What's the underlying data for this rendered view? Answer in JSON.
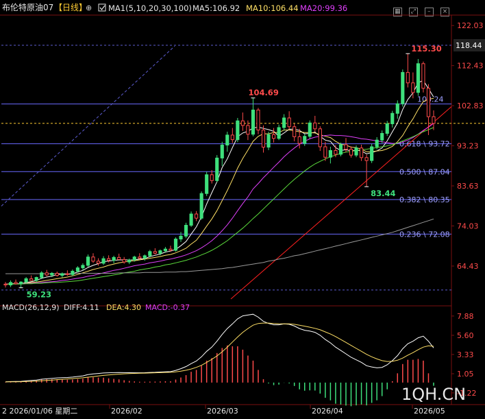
{
  "header": {
    "instrument": "布伦特原油07",
    "period": "【日线】",
    "ma_label": "MA1(5,10,20,30,100)",
    "ma5": "MA5:106.92",
    "ma10": "MA10:106.44",
    "ma20": "MA20:99.36",
    "icons": [
      "grid-icon",
      "expand-icon",
      "minimize-icon",
      "close-icon"
    ]
  },
  "macd_header": {
    "label": "MACD(26,12,9)",
    "diff": "DIFF:4.11",
    "dea": "DEA:4.30",
    "macd": "MACD:-0.37"
  },
  "watermark": "1QH.CN",
  "colors": {
    "up": "#3ee07c",
    "down": "#ff4b4b",
    "ma5": "#ffffff",
    "ma10": "#ffe066",
    "ma20": "#e040fb",
    "ma30": "#5cdc3c",
    "ma100": "#9a9a9a",
    "fib": "#6a6aff",
    "trend": "#ff2020",
    "price_line": "#ffcc33"
  },
  "chart_data": {
    "type": "candlestick",
    "y_ticks": [
      "122.03",
      "112.43",
      "102.83",
      "93.23",
      "83.63",
      "74.03",
      "64.43"
    ],
    "ylim": [
      57.2,
      124.2
    ],
    "current_price": "118.44",
    "x_ticks": [
      "2026/02",
      "2026/03",
      "2026/04",
      "2026/05"
    ],
    "date_label": "2  2026/01/06 星期二",
    "annotations": [
      {
        "text": "115.30",
        "value": 115.3
      },
      {
        "text": "104.69",
        "value": 104.69
      },
      {
        "text": "83.44",
        "value": 83.44
      },
      {
        "text": "59.23",
        "value": 59.23
      }
    ],
    "levels": [
      {
        "label": "",
        "value": 117.3
      },
      {
        "label": "103.24",
        "value": 103.24
      },
      {
        "label": "0.618 \\ 93.72",
        "value": 93.72
      },
      {
        "label": "0.500 \\ 87.04",
        "value": 87.04
      },
      {
        "label": "0.382 \\ 80.35",
        "value": 80.35
      },
      {
        "label": "0.236 \\ 72.08",
        "value": 72.08
      }
    ],
    "macd_ticks": [
      "7.88",
      "5.60",
      "3.33",
      "1.05",
      "-1.22"
    ],
    "macd_ylim": [
      -2.2,
      8.6
    ],
    "candles": [
      [
        60.1,
        60.6,
        59.3,
        59.9
      ],
      [
        59.9,
        61.0,
        59.4,
        60.5
      ],
      [
        60.5,
        61.2,
        60.0,
        60.2
      ],
      [
        60.2,
        60.8,
        59.23,
        60.6
      ],
      [
        60.6,
        61.8,
        60.3,
        61.4
      ],
      [
        61.4,
        62.2,
        60.9,
        61.0
      ],
      [
        61.0,
        61.9,
        60.6,
        61.7
      ],
      [
        61.7,
        63.2,
        61.3,
        62.8
      ],
      [
        62.8,
        63.5,
        62.0,
        62.3
      ],
      [
        62.3,
        63.0,
        61.8,
        62.7
      ],
      [
        62.7,
        63.1,
        61.9,
        62.2
      ],
      [
        62.2,
        62.9,
        61.7,
        62.6
      ],
      [
        62.6,
        63.4,
        62.1,
        62.4
      ],
      [
        62.4,
        63.6,
        62.0,
        63.2
      ],
      [
        63.2,
        64.4,
        62.9,
        64.0
      ],
      [
        64.0,
        65.1,
        63.5,
        64.6
      ],
      [
        64.6,
        67.2,
        64.2,
        66.6
      ],
      [
        66.6,
        67.5,
        65.2,
        65.6
      ],
      [
        65.6,
        66.3,
        64.5,
        65.1
      ],
      [
        65.1,
        66.8,
        64.7,
        66.2
      ],
      [
        66.2,
        67.0,
        65.3,
        65.8
      ],
      [
        65.8,
        66.9,
        65.1,
        66.5
      ],
      [
        66.5,
        67.4,
        65.9,
        66.0
      ],
      [
        66.0,
        66.6,
        65.0,
        65.4
      ],
      [
        65.4,
        66.2,
        64.9,
        65.9
      ],
      [
        65.9,
        66.9,
        65.5,
        66.6
      ],
      [
        66.6,
        67.5,
        66.0,
        66.3
      ],
      [
        66.3,
        67.2,
        65.7,
        66.9
      ],
      [
        66.9,
        68.3,
        66.5,
        67.9
      ],
      [
        67.9,
        68.7,
        67.2,
        67.5
      ],
      [
        67.5,
        68.4,
        67.0,
        68.1
      ],
      [
        68.1,
        69.0,
        67.6,
        68.5
      ],
      [
        68.5,
        69.3,
        67.9,
        68.2
      ],
      [
        68.2,
        71.3,
        67.9,
        70.9
      ],
      [
        70.9,
        72.6,
        70.2,
        71.6
      ],
      [
        71.6,
        74.8,
        71.1,
        74.2
      ],
      [
        74.2,
        77.5,
        73.8,
        76.9
      ],
      [
        76.9,
        77.6,
        75.2,
        75.9
      ],
      [
        75.9,
        82.3,
        75.5,
        81.8
      ],
      [
        81.8,
        87.0,
        81.2,
        86.3
      ],
      [
        86.3,
        87.4,
        84.2,
        84.9
      ],
      [
        84.9,
        91.0,
        84.5,
        90.3
      ],
      [
        90.3,
        94.2,
        88.4,
        93.4
      ],
      [
        93.4,
        96.6,
        91.8,
        95.8
      ],
      [
        95.8,
        97.5,
        93.9,
        94.7
      ],
      [
        94.7,
        99.9,
        94.1,
        99.2
      ],
      [
        99.2,
        101.2,
        96.8,
        98.1
      ],
      [
        98.1,
        99.3,
        94.6,
        96.0
      ],
      [
        96.0,
        104.69,
        95.5,
        101.8
      ],
      [
        101.8,
        102.3,
        96.0,
        97.0
      ],
      [
        97.0,
        98.1,
        91.6,
        92.9
      ],
      [
        92.9,
        96.6,
        92.2,
        95.9
      ],
      [
        95.9,
        97.5,
        94.0,
        95.0
      ],
      [
        95.0,
        98.3,
        94.6,
        97.6
      ],
      [
        97.6,
        100.8,
        96.9,
        99.9
      ],
      [
        99.9,
        101.5,
        97.1,
        97.8
      ],
      [
        97.8,
        98.5,
        94.3,
        95.4
      ],
      [
        95.4,
        97.3,
        92.6,
        93.8
      ],
      [
        93.8,
        96.1,
        93.2,
        95.5
      ],
      [
        95.5,
        99.3,
        95.0,
        98.7
      ],
      [
        98.7,
        100.4,
        96.6,
        97.3
      ],
      [
        97.3,
        97.9,
        92.0,
        93.0
      ],
      [
        93.0,
        94.2,
        89.6,
        90.5
      ],
      [
        90.5,
        93.0,
        89.0,
        92.1
      ],
      [
        92.1,
        93.4,
        90.5,
        91.2
      ],
      [
        91.2,
        94.0,
        90.7,
        93.5
      ],
      [
        93.5,
        95.1,
        91.7,
        92.4
      ],
      [
        92.4,
        93.1,
        90.4,
        91.0
      ],
      [
        91.0,
        93.3,
        90.5,
        92.7
      ],
      [
        92.7,
        93.5,
        89.6,
        90.4
      ],
      [
        90.4,
        91.1,
        83.44,
        89.7
      ],
      [
        89.7,
        93.7,
        89.1,
        93.0
      ],
      [
        93.0,
        95.3,
        92.4,
        94.6
      ],
      [
        94.6,
        96.9,
        93.9,
        96.2
      ],
      [
        96.2,
        99.2,
        95.6,
        98.5
      ],
      [
        98.5,
        101.6,
        97.6,
        101.0
      ],
      [
        101.0,
        104.1,
        99.7,
        103.3
      ],
      [
        103.3,
        111.5,
        102.6,
        110.8
      ],
      [
        110.8,
        115.3,
        107.2,
        108.3
      ],
      [
        108.3,
        110.8,
        104.6,
        106.0
      ],
      [
        106.0,
        114.0,
        105.2,
        112.9
      ],
      [
        112.9,
        113.4,
        106.0,
        107.0
      ],
      [
        107.0,
        108.0,
        95.8,
        100.2
      ],
      [
        100.2,
        101.7,
        97.0,
        98.6
      ]
    ],
    "series": [
      {
        "name": "MA5",
        "values": [
          60.1,
          60.2,
          60.2,
          60.2,
          60.5,
          60.7,
          61.0,
          61.5,
          61.8,
          62.0,
          62.4,
          62.5,
          62.4,
          62.6,
          63.0,
          63.4,
          64.1,
          64.6,
          65.0,
          65.5,
          65.6,
          65.8,
          65.9,
          65.9,
          65.9,
          65.9,
          66.1,
          66.2,
          66.7,
          67.0,
          67.3,
          67.8,
          68.0,
          68.4,
          69.3,
          70.3,
          72.1,
          73.8,
          76.2,
          79.3,
          82.0,
          84.6,
          88.0,
          90.1,
          92.8,
          95.4,
          96.3,
          96.7,
          97.5,
          97.7,
          97.4,
          97.1,
          96.7,
          95.5,
          96.3,
          97.2,
          97.2,
          96.9,
          96.1,
          96.2,
          96.5,
          95.5,
          94.6,
          94.3,
          92.8,
          92.1,
          92.3,
          92.0,
          92.2,
          92.0,
          91.3,
          91.6,
          92.0,
          92.7,
          94.4,
          96.6,
          98.7,
          101.9,
          104.3,
          105.9,
          108.3,
          108.9,
          106.9,
          104.9
        ]
      },
      {
        "name": "MA10",
        "values": [
          60.1,
          60.2,
          60.2,
          60.2,
          60.4,
          60.5,
          60.6,
          60.8,
          61.0,
          61.2,
          61.4,
          61.6,
          61.8,
          62.1,
          62.4,
          62.8,
          63.2,
          63.6,
          63.9,
          64.2,
          64.6,
          64.9,
          65.2,
          65.4,
          65.6,
          65.7,
          65.9,
          66.1,
          66.3,
          66.5,
          66.7,
          67.0,
          67.2,
          67.6,
          68.1,
          68.7,
          69.7,
          70.6,
          72.2,
          74.0,
          75.7,
          77.7,
          80.1,
          82.5,
          85.1,
          87.9,
          90.2,
          92.2,
          94.3,
          95.5,
          96.1,
          96.1,
          96.4,
          96.4,
          97.0,
          97.0,
          96.8,
          96.6,
          96.4,
          96.4,
          96.3,
          95.9,
          95.5,
          95.2,
          94.3,
          93.6,
          93.4,
          92.9,
          92.8,
          92.4,
          91.8,
          91.8,
          92.0,
          92.1,
          92.5,
          93.1,
          94.2,
          95.7,
          97.8,
          99.7,
          101.9,
          103.8,
          104.4,
          104.6
        ]
      },
      {
        "name": "MA20",
        "values": [
          60.1,
          60.1,
          60.2,
          60.2,
          60.3,
          60.3,
          60.4,
          60.5,
          60.6,
          60.7,
          60.8,
          61.0,
          61.1,
          61.3,
          61.5,
          61.7,
          62.0,
          62.2,
          62.5,
          62.8,
          63.1,
          63.4,
          63.6,
          63.9,
          64.2,
          64.5,
          64.7,
          64.9,
          65.2,
          65.4,
          65.6,
          65.9,
          66.1,
          66.4,
          66.7,
          67.1,
          67.6,
          68.1,
          68.8,
          69.6,
          70.5,
          71.6,
          72.9,
          74.3,
          75.9,
          77.7,
          79.4,
          81.0,
          82.9,
          84.2,
          85.6,
          86.8,
          88.1,
          89.3,
          90.6,
          91.7,
          92.7,
          93.6,
          94.3,
          94.9,
          95.3,
          95.5,
          95.7,
          95.8,
          95.7,
          95.7,
          95.6,
          95.4,
          95.2,
          94.9,
          94.8,
          94.6,
          94.4,
          94.2,
          94.0,
          93.8,
          93.8,
          94.1,
          94.6,
          95.2,
          96.0,
          96.9,
          97.7,
          98.6
        ]
      },
      {
        "name": "MA30",
        "values": [
          60.0,
          60.1,
          60.1,
          60.1,
          60.2,
          60.2,
          60.3,
          60.3,
          60.4,
          60.5,
          60.5,
          60.6,
          60.7,
          60.8,
          60.9,
          61.1,
          61.3,
          61.5,
          61.7,
          61.9,
          62.1,
          62.3,
          62.5,
          62.8,
          63.0,
          63.2,
          63.5,
          63.7,
          63.9,
          64.2,
          64.4,
          64.7,
          64.9,
          65.2,
          65.5,
          65.8,
          66.2,
          66.6,
          67.1,
          67.6,
          68.2,
          68.9,
          69.7,
          70.5,
          71.5,
          72.5,
          73.5,
          74.6,
          75.8,
          76.9,
          78.1,
          79.3,
          80.5,
          81.7,
          82.9,
          84.1,
          85.2,
          86.2,
          87.2,
          88.1,
          88.9,
          89.5,
          90.1,
          90.6,
          91.0,
          91.4,
          91.7,
          91.9,
          92.1,
          92.3,
          92.4,
          92.6,
          92.8,
          93.0,
          93.2,
          93.5,
          93.9,
          94.4,
          94.9,
          95.4,
          96.0,
          96.6,
          97.1,
          97.6
        ]
      },
      {
        "name": "MA100",
        "values": [
          62.6,
          62.6,
          62.6,
          62.6,
          62.6,
          62.6,
          62.6,
          62.6,
          62.6,
          62.6,
          62.6,
          62.6,
          62.6,
          62.6,
          62.7,
          62.7,
          62.7,
          62.7,
          62.7,
          62.7,
          62.7,
          62.7,
          62.8,
          62.8,
          62.8,
          62.8,
          62.8,
          62.9,
          62.9,
          62.9,
          62.9,
          63.0,
          63.0,
          63.0,
          63.1,
          63.1,
          63.2,
          63.3,
          63.4,
          63.5,
          63.6,
          63.7,
          63.8,
          64.0,
          64.1,
          64.3,
          64.5,
          64.7,
          64.9,
          65.1,
          65.3,
          65.6,
          65.8,
          66.1,
          66.3,
          66.6,
          66.9,
          67.1,
          67.4,
          67.7,
          68.0,
          68.3,
          68.6,
          68.9,
          69.2,
          69.5,
          69.8,
          70.1,
          70.4,
          70.7,
          71.0,
          71.3,
          71.6,
          71.9,
          72.2,
          72.5,
          72.9,
          73.3,
          73.7,
          74.1,
          74.5,
          74.9,
          75.3,
          75.7
        ]
      }
    ],
    "macd_dif": [
      0.1,
      0.12,
      0.13,
      0.15,
      0.2,
      0.25,
      0.3,
      0.4,
      0.45,
      0.5,
      0.55,
      0.58,
      0.6,
      0.65,
      0.72,
      0.8,
      0.95,
      1.02,
      1.08,
      1.14,
      1.16,
      1.18,
      1.19,
      1.18,
      1.17,
      1.16,
      1.16,
      1.17,
      1.2,
      1.22,
      1.25,
      1.28,
      1.3,
      1.45,
      1.65,
      1.9,
      2.25,
      2.55,
      3.05,
      3.7,
      4.2,
      4.9,
      5.7,
      6.4,
      6.95,
      7.55,
      7.9,
      8.0,
      8.1,
      7.75,
      7.25,
      7.0,
      6.85,
      6.85,
      6.95,
      6.9,
      6.7,
      6.4,
      6.2,
      6.1,
      5.95,
      5.6,
      5.1,
      4.7,
      4.2,
      3.8,
      3.4,
      3.0,
      2.7,
      2.4,
      2.0,
      1.85,
      1.75,
      1.8,
      2.1,
      2.6,
      3.2,
      4.0,
      4.6,
      4.9,
      5.3,
      5.5,
      4.9,
      4.11
    ],
    "macd_dea": [
      0.08,
      0.09,
      0.1,
      0.11,
      0.13,
      0.15,
      0.18,
      0.22,
      0.26,
      0.3,
      0.35,
      0.39,
      0.43,
      0.47,
      0.52,
      0.57,
      0.64,
      0.71,
      0.78,
      0.85,
      0.91,
      0.96,
      1.0,
      1.04,
      1.07,
      1.09,
      1.11,
      1.12,
      1.14,
      1.16,
      1.18,
      1.2,
      1.22,
      1.27,
      1.35,
      1.46,
      1.61,
      1.8,
      2.05,
      2.4,
      2.75,
      3.15,
      3.65,
      4.2,
      4.8,
      5.4,
      5.95,
      6.4,
      6.8,
      7.0,
      7.05,
      7.05,
      7.0,
      6.97,
      6.96,
      6.95,
      6.9,
      6.8,
      6.68,
      6.56,
      6.42,
      6.25,
      6.0,
      5.75,
      5.45,
      5.1,
      4.76,
      4.4,
      4.05,
      3.7,
      3.35,
      3.05,
      2.8,
      2.6,
      2.5,
      2.52,
      2.65,
      2.9,
      3.25,
      3.55,
      3.9,
      4.2,
      4.35,
      4.3
    ]
  }
}
